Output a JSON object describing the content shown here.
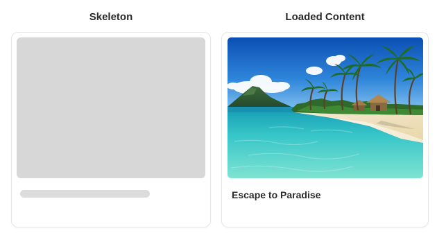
{
  "columns": {
    "left_title": "Skeleton",
    "right_title": "Loaded Content"
  },
  "card": {
    "title": "Escape to Paradise",
    "image_subject": "tropical-beach-photo"
  },
  "colors": {
    "skeleton_fill": "#d7d7d7",
    "card_border": "#e6e6e6",
    "title_text": "#2b2b2b"
  }
}
